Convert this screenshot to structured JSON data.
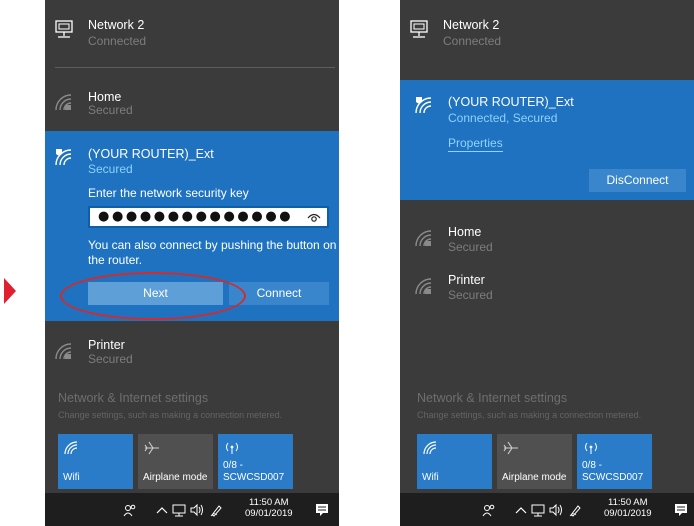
{
  "left_panel": {
    "network2": {
      "name": "Network 2",
      "status": "Connected"
    },
    "home": {
      "name": "Home",
      "status": "Secured"
    },
    "router": {
      "name": "(YOUR ROUTER)_Ext",
      "status": "Secured",
      "key_label": "Enter the network security key",
      "password_value": "●●●●●●●●●●●●●●",
      "push_message": "You can also connect by pushing the button on the router.",
      "next_label": "Next",
      "connect_label": "Connect"
    },
    "printer": {
      "name": "Printer",
      "status": "Secured"
    },
    "settings": {
      "title": "Network & Internet settings",
      "subtitle": "Change settings, such as making a connection metered."
    },
    "tiles": [
      {
        "label": "Wifi",
        "active": true
      },
      {
        "label": "Airplane mode",
        "active": false
      },
      {
        "label_top": "0/8 -",
        "label": "SCWCSD007",
        "active": true
      }
    ],
    "taskbar": {
      "time": "11:50 AM",
      "date": "09/01/2019"
    }
  },
  "right_panel": {
    "network2": {
      "name": "Network 2",
      "status": "Connected"
    },
    "router": {
      "name": "(YOUR ROUTER)_Ext",
      "status": "Connected, Secured",
      "properties_label": "Properties",
      "disconnect_label": "DisConnect"
    },
    "home": {
      "name": "Home",
      "status": "Secured"
    },
    "printer": {
      "name": "Printer",
      "status": "Secured"
    },
    "settings": {
      "title": "Network & Internet settings",
      "subtitle": "Change settings, such as making a connection metered."
    },
    "tiles": [
      {
        "label": "Wifi",
        "active": true
      },
      {
        "label": "Airplane mode",
        "active": false
      },
      {
        "label_top": "0/8 -",
        "label": "SCWCSD007",
        "active": true
      }
    ],
    "taskbar": {
      "time": "11:50 AM",
      "date": "09/01/2019"
    }
  },
  "colors": {
    "flyout_background": "#3b3b3b",
    "selected_network": "#1e72c0",
    "active_tile": "#2a7cc9",
    "highlight": "#d62a2a",
    "taskbar": "#1e1e1e"
  },
  "icons": {
    "wired_network": "ethernet-monitor-icon",
    "wifi_secured": "wifi-lock-icon",
    "wifi_shield": "wifi-shield-icon",
    "airplane": "airplane-icon",
    "hotspot": "mobile-hotspot-icon",
    "people": "people-icon",
    "chevron_up": "chevron-up-icon",
    "volume": "speaker-icon",
    "pen": "pen-icon",
    "notifications": "notification-icon"
  }
}
